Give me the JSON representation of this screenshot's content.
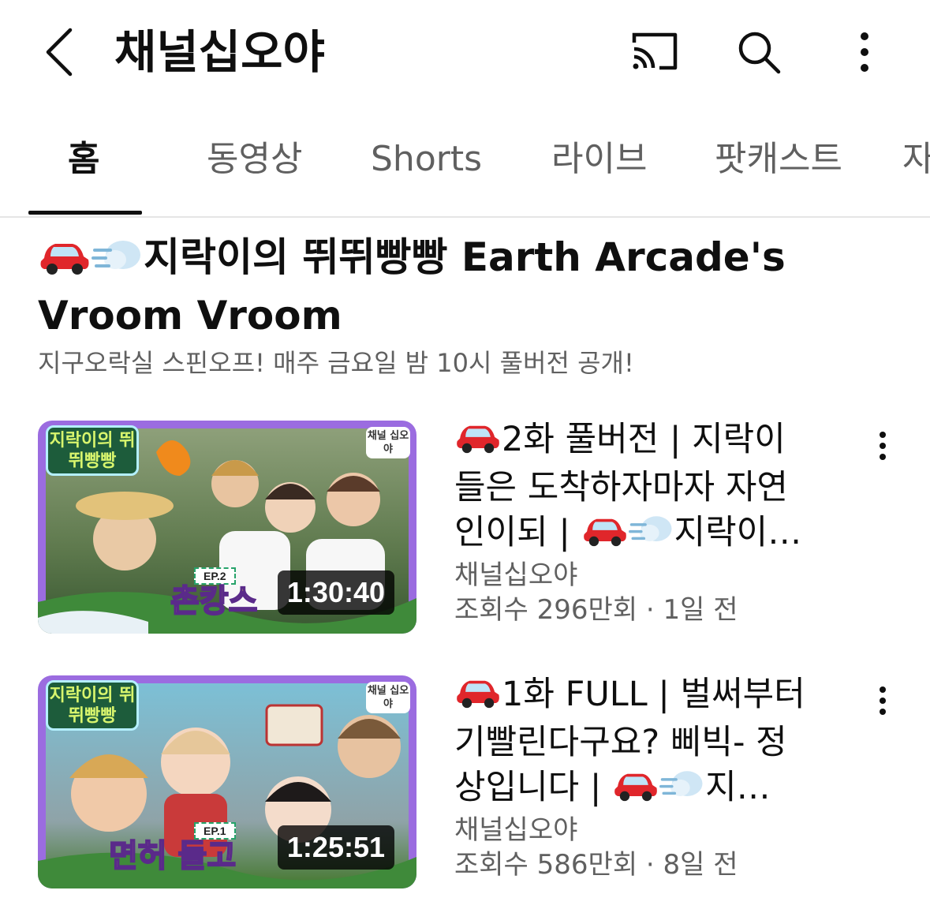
{
  "header": {
    "title": "채널십오야",
    "back_icon": "back-arrow-icon",
    "actions": [
      "cast-icon",
      "search-icon",
      "more-vert-icon"
    ]
  },
  "tabs": [
    {
      "label": "홈",
      "active": true
    },
    {
      "label": "동영상",
      "active": false
    },
    {
      "label": "Shorts",
      "active": false
    },
    {
      "label": "라이브",
      "active": false
    },
    {
      "label": "팟캐스트",
      "active": false
    },
    {
      "label": "자",
      "active": false
    }
  ],
  "section": {
    "title_text": "지락이의 뛰뛰빵빵 Earth Arcade's Vroom Vroom",
    "title_icons": [
      "car-icon",
      "dash-icon"
    ],
    "subtitle": "지구오락실 스핀오프! 매주 금요일 밤 10시 풀버전 공개!"
  },
  "videos": [
    {
      "title_line1": "2화 풀버전 | 지락이",
      "title_line2": "들은 도착하자마자 자연",
      "title_line3_a": "인이되 | ",
      "title_line3_b": "지락이…",
      "channel": "채널십오야",
      "meta": "조회수 296만회 · 1일 전",
      "duration": "1:30:40",
      "thumb_logo": "지락이의 뛰뛰빵빵",
      "thumb_corner": "채널 십오야",
      "thumb_ep": "EP.2",
      "thumb_caption": "촌캉스",
      "thumb_colors": [
        "#7a8f6a",
        "#3f5a3a",
        "#b7a98f"
      ]
    },
    {
      "title_line1": "1화 FULL | 벌써부터",
      "title_line2": "기빨린다구요? 삐빅- 정",
      "title_line3_a": "상입니다 | ",
      "title_line3_b": "지…",
      "channel": "채널십오야",
      "meta": "조회수 586만회 · 8일 전",
      "duration": "1:25:51",
      "thumb_logo": "지락이의 뛰뛰빵빵",
      "thumb_corner": "채널 십오야",
      "thumb_ep": "EP.1",
      "thumb_caption": "면허 들고",
      "thumb_colors": [
        "#6fb3c8",
        "#c27a4d",
        "#e8d5c0"
      ]
    }
  ],
  "colors": {
    "text_primary": "#0f0f0f",
    "text_secondary": "#606060",
    "divider": "#e5e5e5",
    "thumb_frame": "#9b6ce0"
  }
}
